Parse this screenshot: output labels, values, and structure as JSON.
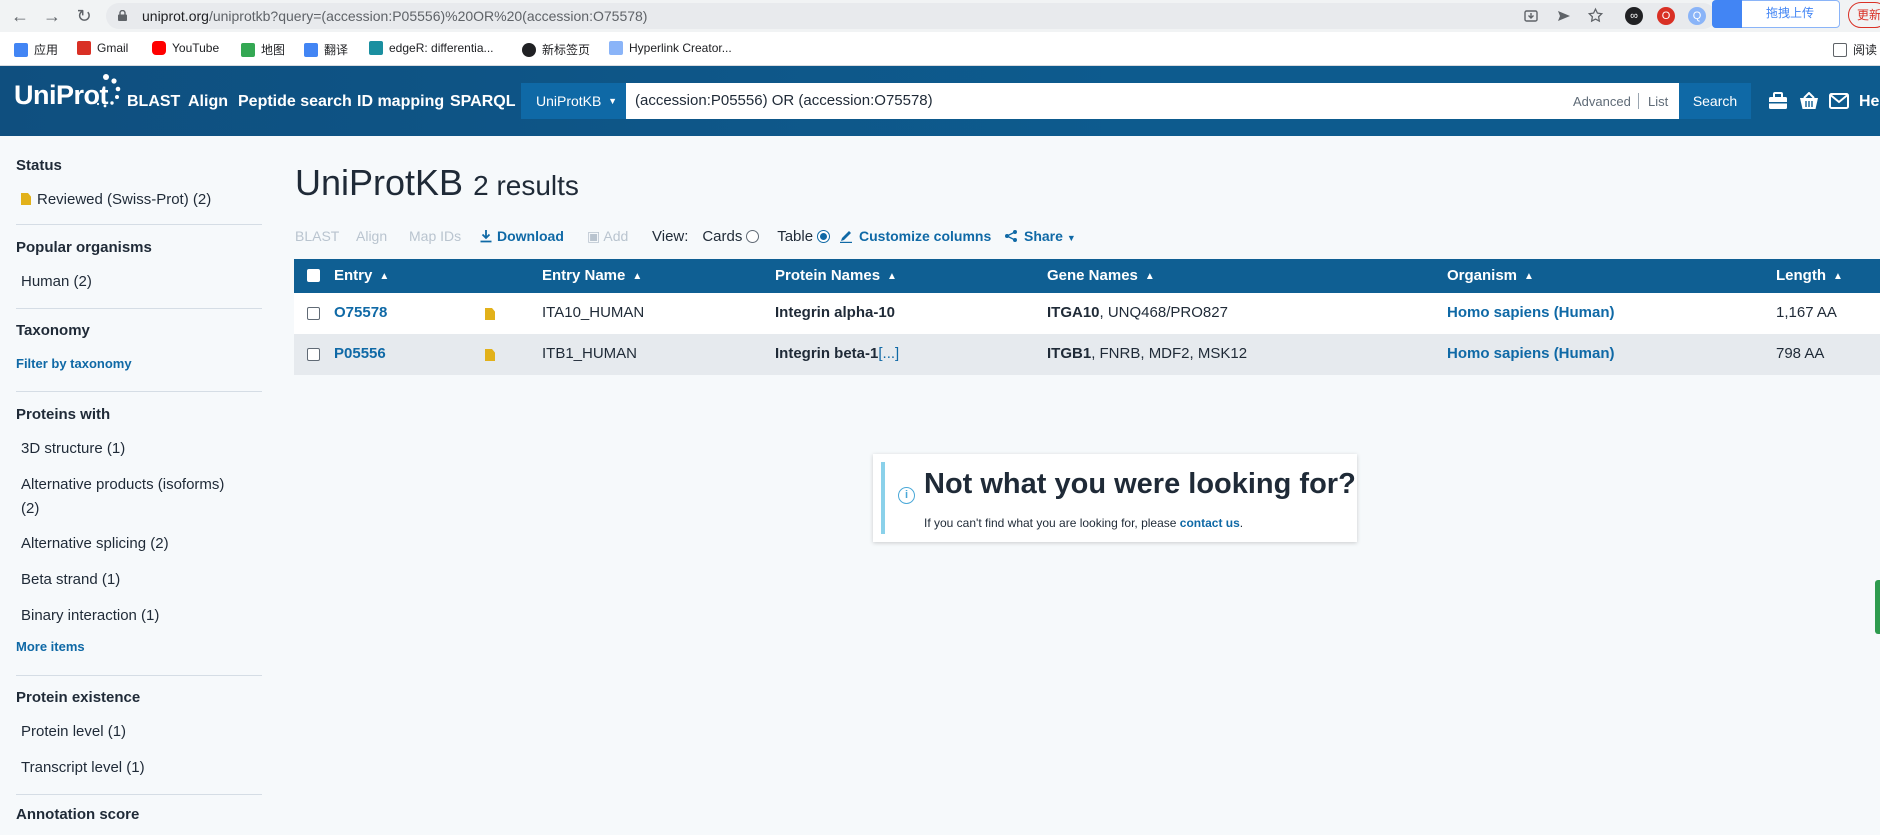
{
  "browser": {
    "url_host": "uniprot.org",
    "url_path": "/uniprotkb?query=(accession:P05556)%20OR%20(accession:O75578)",
    "upload_label": "拖拽上传",
    "update_label": "更新",
    "bookmarks": [
      {
        "label": "应用",
        "icon": "apps-grid-icon",
        "color": "#4285f4"
      },
      {
        "label": "Gmail",
        "icon": "gmail-icon",
        "color": "#d93025"
      },
      {
        "label": "YouTube",
        "icon": "youtube-icon",
        "color": "#ff0000"
      },
      {
        "label": "地图",
        "icon": "maps-icon",
        "color": "#34a853"
      },
      {
        "label": "翻译",
        "icon": "translate-icon",
        "color": "#4285f4"
      },
      {
        "label": "edgeR: differentia...",
        "icon": "bioconductor-icon",
        "color": "#1a8fa0"
      },
      {
        "label": "新标签页",
        "icon": "new-tab-icon",
        "color": "#202124"
      },
      {
        "label": "Hyperlink Creator...",
        "icon": "bird-icon",
        "color": "#8ab4f8"
      }
    ],
    "reading_list_label": "阅读"
  },
  "header": {
    "logo": "UniProt",
    "nav": [
      "BLAST",
      "Align",
      "Peptide search",
      "ID mapping",
      "SPARQL"
    ],
    "database": "UniProtKB",
    "query": "(accession:P05556) OR (accession:O75578)",
    "advanced_label": "Advanced",
    "list_label": "List",
    "search_label": "Search",
    "help_label": "He"
  },
  "sidebar": {
    "status_title": "Status",
    "status_item": "Reviewed (Swiss-Prot) (2)",
    "organisms_title": "Popular organisms",
    "organisms_item": "Human (2)",
    "taxonomy_title": "Taxonomy",
    "taxonomy_link": "Filter by taxonomy",
    "proteins_with_title": "Proteins with",
    "proteins_with_items": [
      "3D structure (1)",
      "Alternative products (isoforms)",
      "(2)",
      "Alternative splicing (2)",
      "Beta strand (1)",
      "Binary interaction (1)"
    ],
    "more_items": "More items",
    "existence_title": "Protein existence",
    "existence_items": [
      "Protein level (1)",
      "Transcript level (1)"
    ],
    "annotation_title": "Annotation score"
  },
  "main": {
    "title": "UniProtKB",
    "results": "2 results",
    "toolbar": {
      "blast": "BLAST",
      "align": "Align",
      "map_ids": "Map IDs",
      "download": "Download",
      "add": "Add",
      "view_label": "View:",
      "cards": "Cards",
      "table": "Table",
      "customize": "Customize columns",
      "share": "Share"
    },
    "columns": [
      "Entry",
      "Entry Name",
      "Protein Names",
      "Gene Names",
      "Organism",
      "Length"
    ],
    "rows": [
      {
        "entry": "O75578",
        "entry_name": "ITA10_HUMAN",
        "protein": "Integrin alpha-10",
        "protein_more": "",
        "gene_primary": "ITGA10",
        "gene_others": ", UNQ468/PRO827",
        "organism": "Homo sapiens (Human)",
        "length": "1,167 AA"
      },
      {
        "entry": "P05556",
        "entry_name": "ITB1_HUMAN",
        "protein": "Integrin beta-1",
        "protein_more": "[...]",
        "gene_primary": "ITGB1",
        "gene_others": ", FNRB, MDF2, MSK12",
        "organism": "Homo sapiens (Human)",
        "length": "798 AA"
      }
    ],
    "callout": {
      "title": "Not what you were looking for?",
      "text": "If you can't find what you are looking for, please ",
      "link": "contact us",
      "end": "."
    }
  },
  "colors": {
    "header_blue": "#0f5f93",
    "link_blue": "#0f69a6",
    "reviewed_gold": "#e2b11a"
  }
}
